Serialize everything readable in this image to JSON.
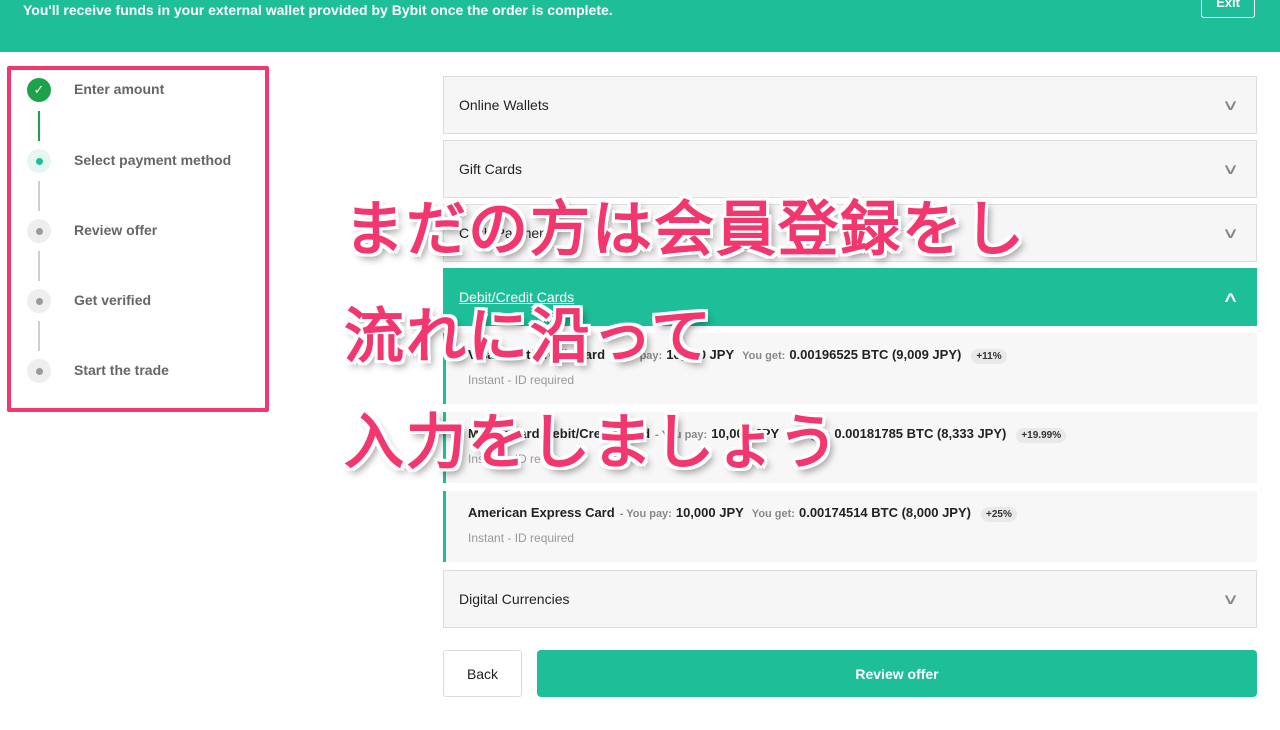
{
  "banner": {
    "message": "You'll receive funds in your external wallet provided by Bybit once the order is complete.",
    "exit_label": "Exit"
  },
  "stepper": {
    "steps": [
      {
        "label": "Enter amount",
        "status": "done"
      },
      {
        "label": "Select payment method",
        "status": "active"
      },
      {
        "label": "Review offer",
        "status": "pending"
      },
      {
        "label": "Get verified",
        "status": "pending"
      },
      {
        "label": "Start the trade",
        "status": "pending"
      }
    ]
  },
  "payment": {
    "categories": [
      {
        "label": "Online Wallets"
      },
      {
        "label": "Gift Cards"
      },
      {
        "label": "Cash Payment"
      },
      {
        "label": "Debit/Credit Cards",
        "expanded": true
      },
      {
        "label": "Digital Currencies"
      }
    ],
    "offers": [
      {
        "name": "Visa Debit/Credit Card",
        "pay_label": "- You pay:",
        "pay": "10,000 JPY",
        "get_label": "You get:",
        "get": "0.00196525 BTC (9,009 JPY)",
        "badge": "+11%",
        "sub": "Instant - ID required"
      },
      {
        "name": "MasterCard Debit/Credit Card",
        "pay_label": "- You pay:",
        "pay": "10,000 JPY",
        "get_label": "You get:",
        "get": "0.00181785 BTC (8,333 JPY)",
        "badge": "+19.99%",
        "sub": "Instant - ID required"
      },
      {
        "name": "American Express Card",
        "pay_label": "- You pay:",
        "pay": "10,000 JPY",
        "get_label": "You get:",
        "get": "0.00174514 BTC (8,000 JPY)",
        "badge": "+25%",
        "sub": "Instant - ID required"
      }
    ]
  },
  "actions": {
    "back_label": "Back",
    "review_label": "Review offer"
  },
  "overlay": {
    "lines": [
      "まだの方は会員登録をし",
      "流れに沿って",
      "入力をしましょう"
    ]
  },
  "colors": {
    "accent": "#1dbe98",
    "highlight": "#f2366e",
    "done": "#1ba24a"
  }
}
